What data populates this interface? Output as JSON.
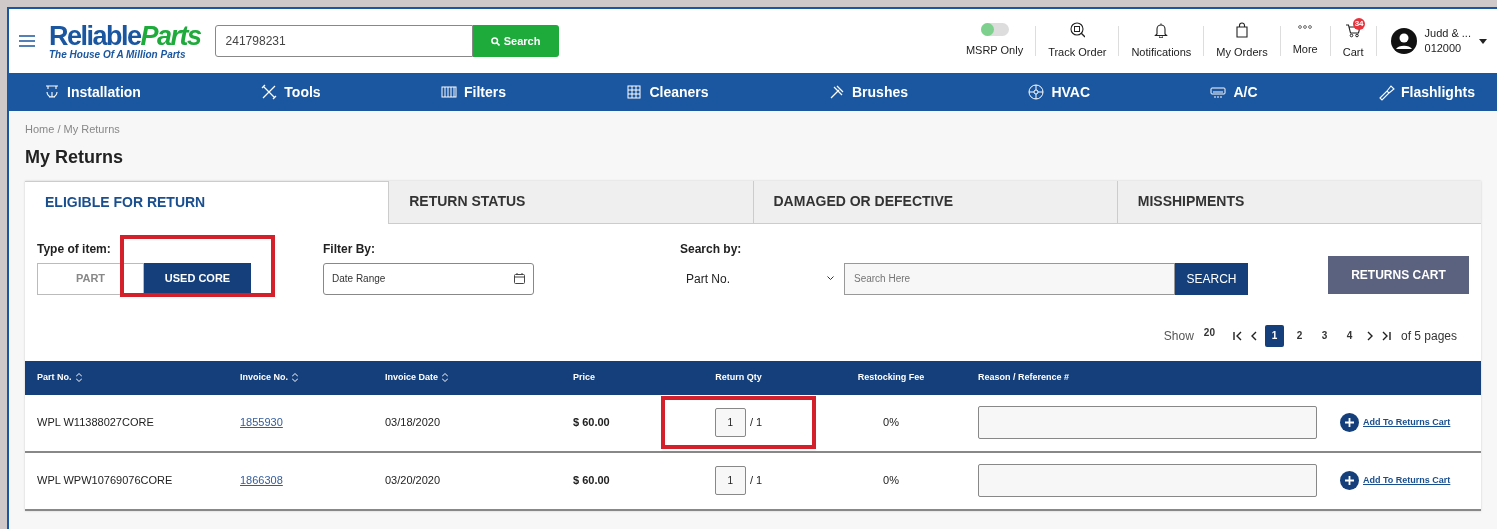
{
  "header": {
    "logo_primary": "Reliable",
    "logo_secondary": "Parts",
    "tagline": "The House Of A Million Parts",
    "search": {
      "value": "241798231",
      "button": "Search"
    },
    "msrp": {
      "label": "MSRP Only",
      "on": true
    },
    "links": [
      {
        "kind": "track",
        "label": "Track Order"
      },
      {
        "kind": "bell",
        "label": "Notifications"
      },
      {
        "kind": "bag",
        "label": "My Orders"
      },
      {
        "kind": "more",
        "label": "More"
      },
      {
        "kind": "cart",
        "label": "Cart",
        "badge": "34"
      }
    ],
    "user": {
      "name": "Judd & ...",
      "account": "012000"
    }
  },
  "categories": [
    {
      "kind": "install",
      "label": "Installation"
    },
    {
      "kind": "tools",
      "label": "Tools"
    },
    {
      "kind": "filter",
      "label": "Filters"
    },
    {
      "kind": "cleaner",
      "label": "Cleaners"
    },
    {
      "kind": "brush",
      "label": "Brushes"
    },
    {
      "kind": "fan",
      "label": "HVAC"
    },
    {
      "kind": "ac",
      "label": "A/C"
    },
    {
      "kind": "flashlight",
      "label": "Flashlights"
    }
  ],
  "breadcrumb": "Home / My Returns",
  "title": "My Returns",
  "tabs": [
    {
      "label": "ELIGIBLE FOR RETURN",
      "selected": true
    },
    {
      "label": "RETURN STATUS",
      "selected": false
    },
    {
      "label": "DAMAGED OR DEFECTIVE",
      "selected": false
    },
    {
      "label": "MISSHIPMENTS",
      "selected": false
    }
  ],
  "type_of_item": {
    "label": "Type of item:",
    "highlighted": true,
    "options": [
      {
        "label": "PART",
        "selected": false
      },
      {
        "label": "USED CORE",
        "selected": true
      }
    ]
  },
  "filter_by": {
    "label": "Filter By:",
    "placeholder": "Date Range"
  },
  "search_by": {
    "label": "Search by:",
    "value": "Part No.",
    "placeholder": "Search Here",
    "button": "SEARCH"
  },
  "returns_cart": "RETURNS CART",
  "pagination": {
    "show": "Show",
    "page_size": "20",
    "pages": [
      {
        "label": "1",
        "selected": true
      },
      {
        "label": "2",
        "selected": false
      },
      {
        "label": "3",
        "selected": false
      },
      {
        "label": "4",
        "selected": false
      }
    ],
    "total": "of 5 pages"
  },
  "table": {
    "columns": [
      {
        "label": "Part No.",
        "sortable": true
      },
      {
        "label": "Invoice No.",
        "sortable": true
      },
      {
        "label": "Invoice Date",
        "sortable": true
      },
      {
        "label": "Price",
        "sortable": false
      },
      {
        "label": "Return Qty",
        "sortable": false
      },
      {
        "label": "Restocking Fee",
        "sortable": false
      },
      {
        "label": "Reason / Reference #",
        "sortable": false
      }
    ],
    "rows": [
      {
        "part": "WPL W11388027CORE",
        "invoice": "1855930",
        "date": "03/18/2020",
        "price": "$ 60.00",
        "qty": "1",
        "qty_max": "/ 1",
        "fee": "0%",
        "action": "Add To Returns Cart",
        "qty_highlighted": true
      },
      {
        "part": "WPL WPW10769076CORE",
        "invoice": "1866308",
        "date": "03/20/2020",
        "price": "$ 60.00",
        "qty": "1",
        "qty_max": "/ 1",
        "fee": "0%",
        "action": "Add To Returns Cart",
        "qty_highlighted": false
      }
    ]
  }
}
